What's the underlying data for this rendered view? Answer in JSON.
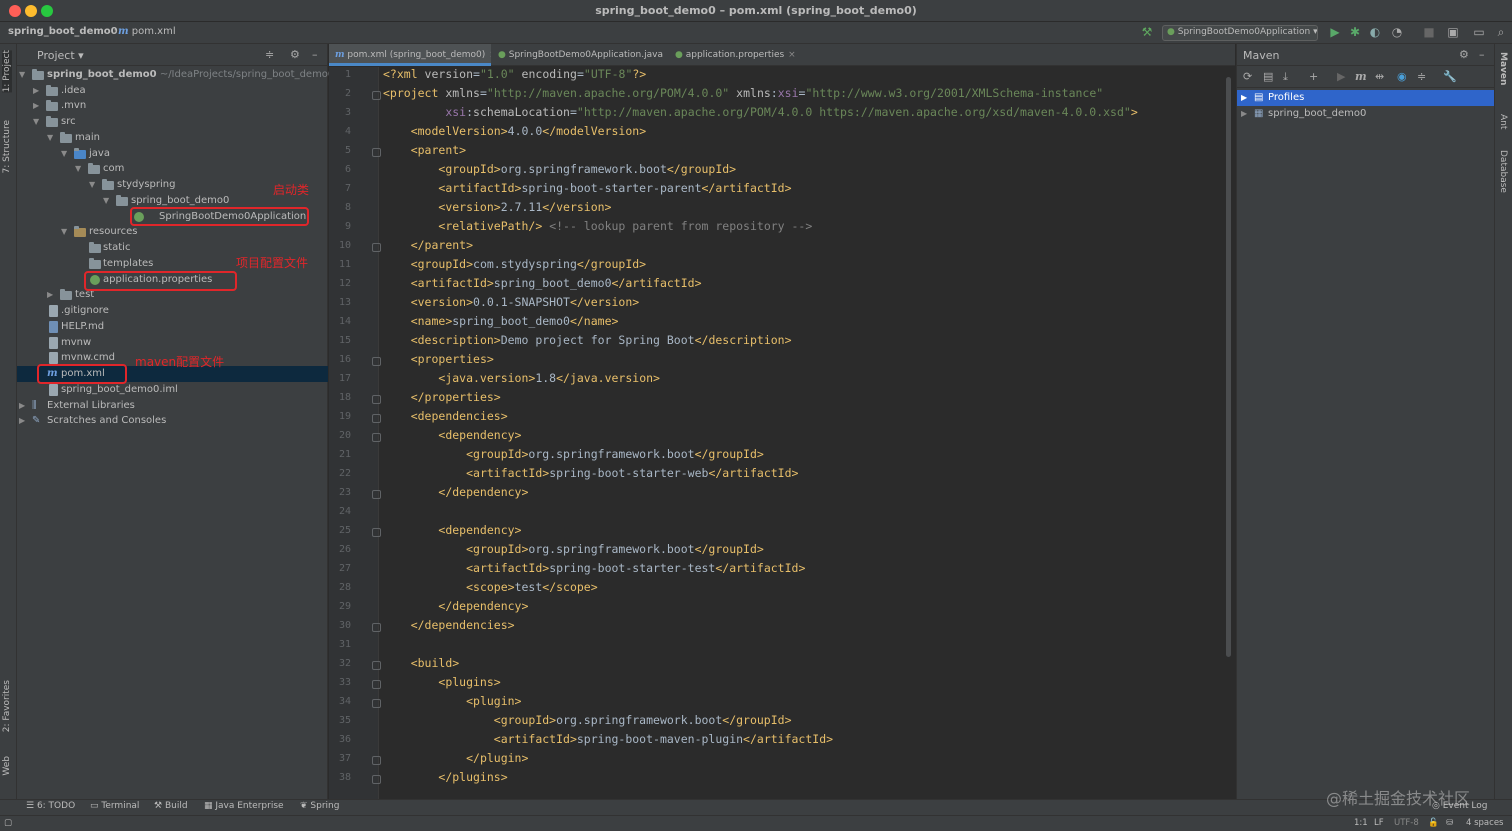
{
  "window": {
    "title": "spring_boot_demo0 – pom.xml (spring_boot_demo0)"
  },
  "navbar": {
    "project_crumb": "spring_boot_demo0",
    "file_crumb": "pom.xml",
    "run_config": "SpringBootDemo0Application"
  },
  "left_stripe": {
    "project": "1: Project",
    "structure": "7: Structure",
    "favorites": "2: Favorites",
    "web": "Web"
  },
  "right_stripe": {
    "maven": "Maven",
    "ant": "Ant",
    "database": "Database"
  },
  "project_panel": {
    "title": "Project",
    "root_name": "spring_boot_demo0",
    "root_path": "~/IdeaProjects/spring_boot_demo0",
    "items": [
      ".idea",
      ".mvn",
      "src",
      "main",
      "java",
      "com",
      "stydyspring",
      "spring_boot_demo0",
      "SpringBootDemo0Application",
      "resources",
      "static",
      "templates",
      "application.properties",
      "test",
      ".gitignore",
      "HELP.md",
      "mvnw",
      "mvnw.cmd",
      "pom.xml",
      "spring_boot_demo0.iml",
      "External Libraries",
      "Scratches and Consoles"
    ]
  },
  "annotations": {
    "startup_class": "启动类",
    "project_config": "项目配置文件",
    "maven_config": "maven配置文件"
  },
  "editor": {
    "tabs": [
      "pom.xml (spring_boot_demo0)",
      "SpringBootDemo0Application.java",
      "application.properties"
    ],
    "line_numbers": [
      "1",
      "2",
      "3",
      "4",
      "5",
      "6",
      "7",
      "8",
      "9",
      "10",
      "11",
      "12",
      "13",
      "14",
      "15",
      "16",
      "17",
      "18",
      "19",
      "20",
      "21",
      "22",
      "23",
      "24",
      "25",
      "26",
      "27",
      "28",
      "29",
      "30",
      "31",
      "32",
      "33",
      "34",
      "35",
      "36",
      "37",
      "38"
    ],
    "xml": {
      "version": "1.0",
      "encoding": "UTF-8",
      "xmlns": "http://maven.apache.org/POM/4.0.0",
      "xmlns_xsi": "http://www.w3.org/2001/XMLSchema-instance",
      "schema_location": "http://maven.apache.org/POM/4.0.0 https://maven.apache.org/xsd/maven-4.0.0.xsd"
    },
    "values": {
      "model_version": "4.0.0",
      "parent_group_id": "org.springframework.boot",
      "parent_artifact_id": "spring-boot-starter-parent",
      "parent_version": "2.7.11",
      "relative_path_comment": "<!-- lookup parent from repository -->",
      "group_id": "com.stydyspring",
      "artifact_id": "spring_boot_demo0",
      "version": "0.0.1-SNAPSHOT",
      "name": "spring_boot_demo0",
      "description": "Demo project for Spring Boot",
      "java_version": "1.8",
      "dep1_group_id": "org.springframework.boot",
      "dep1_artifact_id": "spring-boot-starter-web",
      "dep2_group_id": "org.springframework.boot",
      "dep2_artifact_id": "spring-boot-starter-test",
      "dep2_scope": "test",
      "plugin_group_id": "org.springframework.boot",
      "plugin_artifact_id": "spring-boot-maven-plugin"
    }
  },
  "maven_panel": {
    "title": "Maven",
    "items": [
      "Profiles",
      "spring_boot_demo0"
    ]
  },
  "bottom_tabs": [
    "6: TODO",
    "Terminal",
    "Build",
    "Java Enterprise",
    "Spring"
  ],
  "status": {
    "event_log": "Event Log",
    "position": "1:1",
    "line_sep": "LF",
    "encoding": "UTF-8",
    "indent": "4 spaces"
  },
  "watermark": "@稀土掘金技术社区"
}
